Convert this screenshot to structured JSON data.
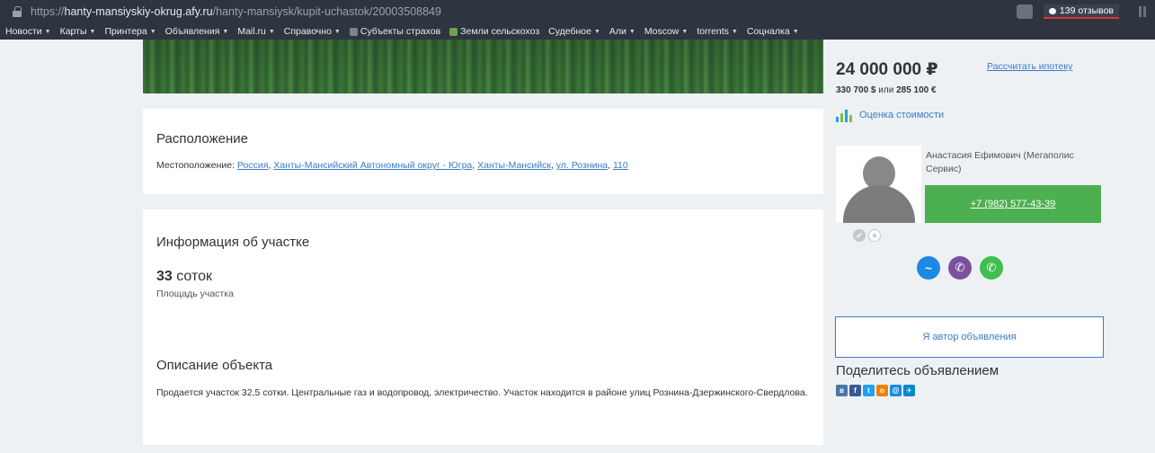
{
  "browser": {
    "url_prefix": "https://",
    "url_host": "hanty-mansiyskiy-okrug.afy.ru",
    "url_path": "/hanty-mansiysk/kupit-uchastok/20003508849",
    "reviews_label": "139 отзывов"
  },
  "bookmarks": [
    {
      "label": "Новости",
      "caret": "▼"
    },
    {
      "label": "Карты",
      "caret": "▼"
    },
    {
      "label": "Принтера",
      "caret": "▼"
    },
    {
      "label": "Объявления",
      "caret": "▼"
    },
    {
      "label": "Mail.ru",
      "caret": "▼"
    },
    {
      "label": "Справочно",
      "caret": "▼"
    },
    {
      "label": "Субъекты страхов",
      "caret": ""
    },
    {
      "label": "Земли сельскохоз",
      "caret": ""
    },
    {
      "label": "Судебное",
      "caret": "▼"
    },
    {
      "label": "Али",
      "caret": "▼"
    },
    {
      "label": "Moscow",
      "caret": "▼"
    },
    {
      "label": "torrents",
      "caret": "▼"
    },
    {
      "label": "Соцналка",
      "caret": "▼"
    }
  ],
  "location": {
    "title": "Расположение",
    "prefix": "Местоположение: ",
    "links": [
      "Россия",
      "Ханты-Мансийский Автономный округ - Югра",
      "Ханты-Мансийск",
      "ул. Рознина",
      "110"
    ],
    "separator": ", "
  },
  "info": {
    "title": "Информация об участке",
    "area_value": "33",
    "area_unit": " соток",
    "area_label": "Площадь участка"
  },
  "description": {
    "title": "Описание объекта",
    "text": "Продается участок 32,5 сотки. Центральные газ и водопровод, электричество. Участок находится в районе улиц Рознина-Дзержинского-Свердлова."
  },
  "price": {
    "main": "24 000 000 ₽",
    "mortgage_link": "Рассчитать ипотеку",
    "alt_prefix": "330 700 $",
    "alt_middle": " или ",
    "alt_suffix": "285 100 €",
    "estimate_label": "Оценка стоимости"
  },
  "agent": {
    "name": "Анастасия Ефимович (Мегаполис Сервис)",
    "phone": "+7 (982) 577-43-39"
  },
  "actions": {
    "author_button": "Я автор объявления",
    "share_title": "Поделитесь объявлением"
  },
  "colors": {
    "phone_button": "#4caf50",
    "link": "#3a7bc8",
    "messenger_fb": "#1e88e5",
    "messenger_viber": "#7b519d",
    "messenger_whatsapp": "#3fbf4f"
  }
}
